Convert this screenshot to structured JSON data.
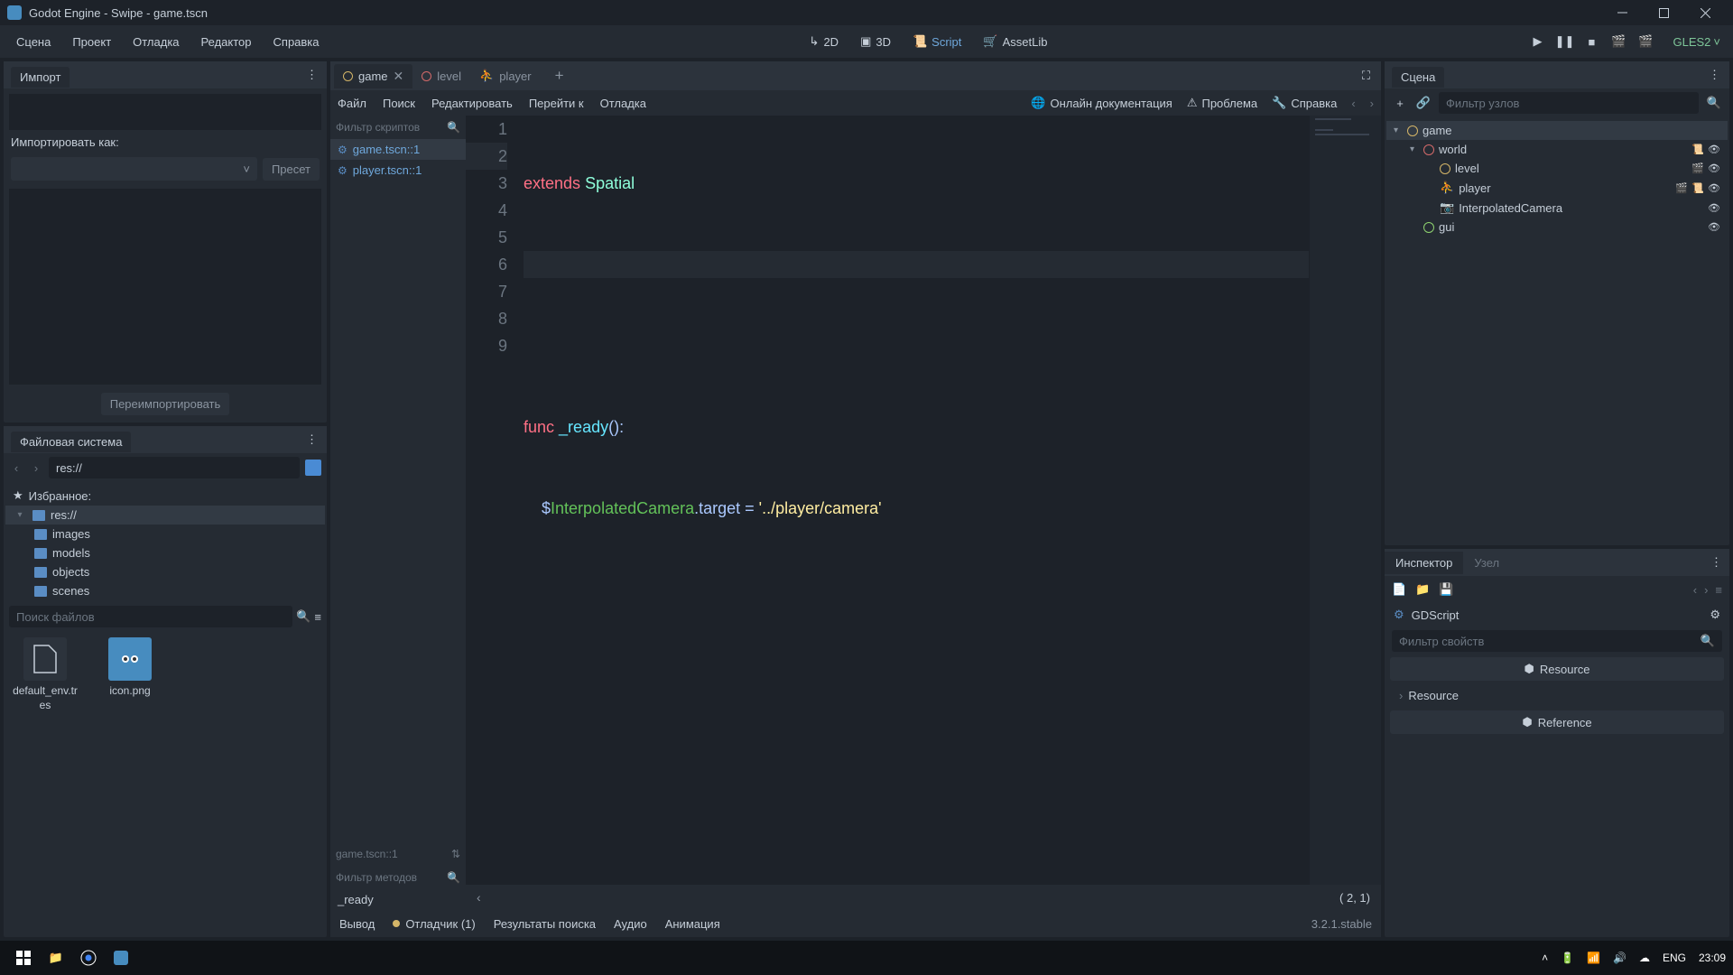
{
  "window": {
    "title": "Godot Engine - Swipe - game.tscn"
  },
  "menu": [
    "Сцена",
    "Проект",
    "Отладка",
    "Редактор",
    "Справка"
  ],
  "views": {
    "v2d": "2D",
    "v3d": "3D",
    "script": "Script",
    "assetlib": "AssetLib"
  },
  "renderer": "GLES2",
  "import": {
    "title": "Импорт",
    "importAs": "Импортировать как:",
    "preset": "Пресет",
    "reimport": "Переимпортировать"
  },
  "fs": {
    "title": "Файловая система",
    "path": "res://",
    "favorites": "Избранное:",
    "root": "res://",
    "folders": [
      "images",
      "models",
      "objects",
      "scenes"
    ],
    "searchPlaceholder": "Поиск файлов",
    "files": [
      "default_env.tres",
      "icon.png"
    ]
  },
  "scriptTabs": {
    "game": "game",
    "level": "level",
    "player": "player"
  },
  "scriptMenu": [
    "Файл",
    "Поиск",
    "Редактировать",
    "Перейти к",
    "Отладка"
  ],
  "scriptHelp": {
    "docs": "Онлайн документация",
    "problem": "Проблема",
    "help": "Справка"
  },
  "scriptList": {
    "filter": "Фильтр скриптов",
    "items": [
      {
        "label": "game.tscn::1"
      },
      {
        "label": "player.tscn::1"
      }
    ],
    "current": "game.tscn::1",
    "methodFilter": "Фильтр методов",
    "method": "_ready"
  },
  "code": {
    "line1_kw": "extends",
    "line1_cls": "Spatial",
    "line4_kw": "func",
    "line4_fn": "_ready",
    "line5_indentkw": "$",
    "line5_var": "InterpolatedCamera",
    "line5_prop": ".target = ",
    "line5_str": "'../player/camera'",
    "pos": "(    2,    1)"
  },
  "bottom": {
    "output": "Вывод",
    "debugger": "Отладчик (1)",
    "search": "Результаты поиска",
    "audio": "Аудио",
    "anim": "Анимация",
    "version": "3.2.1.stable"
  },
  "scene": {
    "title": "Сцена",
    "filter": "Фильтр узлов",
    "nodes": [
      {
        "name": "game",
        "color": "#d4b568",
        "indent": 0,
        "expand": true,
        "icons": []
      },
      {
        "name": "world",
        "color": "#d46a6a",
        "indent": 1,
        "expand": true,
        "icons": [
          "script",
          "eye"
        ]
      },
      {
        "name": "level",
        "color": "#d4b568",
        "indent": 2,
        "icons": [
          "open",
          "eye"
        ]
      },
      {
        "name": "player",
        "color": "#d46a6a",
        "indent": 2,
        "icons": [
          "open",
          "script",
          "eye"
        ],
        "redico": true
      },
      {
        "name": "InterpolatedCamera",
        "color": "#d46a6a",
        "indent": 2,
        "icons": [
          "eye"
        ],
        "camico": true
      },
      {
        "name": "gui",
        "color": "#8fd470",
        "indent": 1,
        "icons": [
          "eye"
        ]
      }
    ]
  },
  "inspector": {
    "tabs": {
      "insp": "Инспектор",
      "node": "Узел"
    },
    "script": "GDScript",
    "filter": "Фильтр свойств",
    "resource": "Resource",
    "reference": "Reference"
  },
  "taskbar": {
    "lang": "ENG",
    "time": "23:09"
  }
}
